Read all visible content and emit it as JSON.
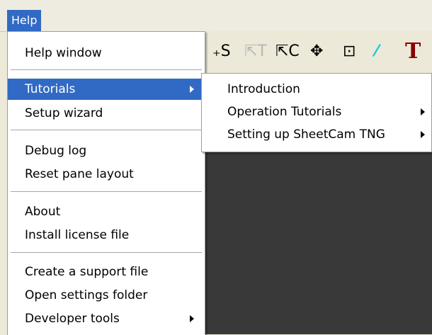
{
  "menubar": {
    "help_label": "Help"
  },
  "toolbar": {
    "icons": [
      {
        "name": "start-point-icon",
        "glyph": "₊S"
      },
      {
        "name": "select-text-icon",
        "glyph": "⇱T"
      },
      {
        "name": "select-contour-icon",
        "glyph": "⇱C"
      },
      {
        "name": "move-icon",
        "glyph": "✥"
      },
      {
        "name": "rotate-icon",
        "glyph": "⊡"
      },
      {
        "name": "lead-icon",
        "glyph": "⁄"
      },
      {
        "name": "text-tool-icon",
        "glyph": "T"
      }
    ]
  },
  "help_menu": {
    "items": [
      {
        "label": "Help window"
      },
      {
        "label": "Tutorials"
      },
      {
        "label": "Setup wizard"
      },
      {
        "label": "Debug log"
      },
      {
        "label": "Reset pane layout"
      },
      {
        "label": "About"
      },
      {
        "label": "Install license file"
      },
      {
        "label": "Create a support file"
      },
      {
        "label": "Open settings folder"
      },
      {
        "label": "Developer tools"
      }
    ]
  },
  "tutorials_menu": {
    "items": [
      {
        "label": "Introduction"
      },
      {
        "label": "Operation Tutorials"
      },
      {
        "label": "Setting up SheetCam TNG"
      }
    ]
  },
  "colors": {
    "selection": "#316ac5",
    "canvas": "#393939",
    "text_icon": "#8b0000",
    "lead_icon": "#00c8e6"
  }
}
